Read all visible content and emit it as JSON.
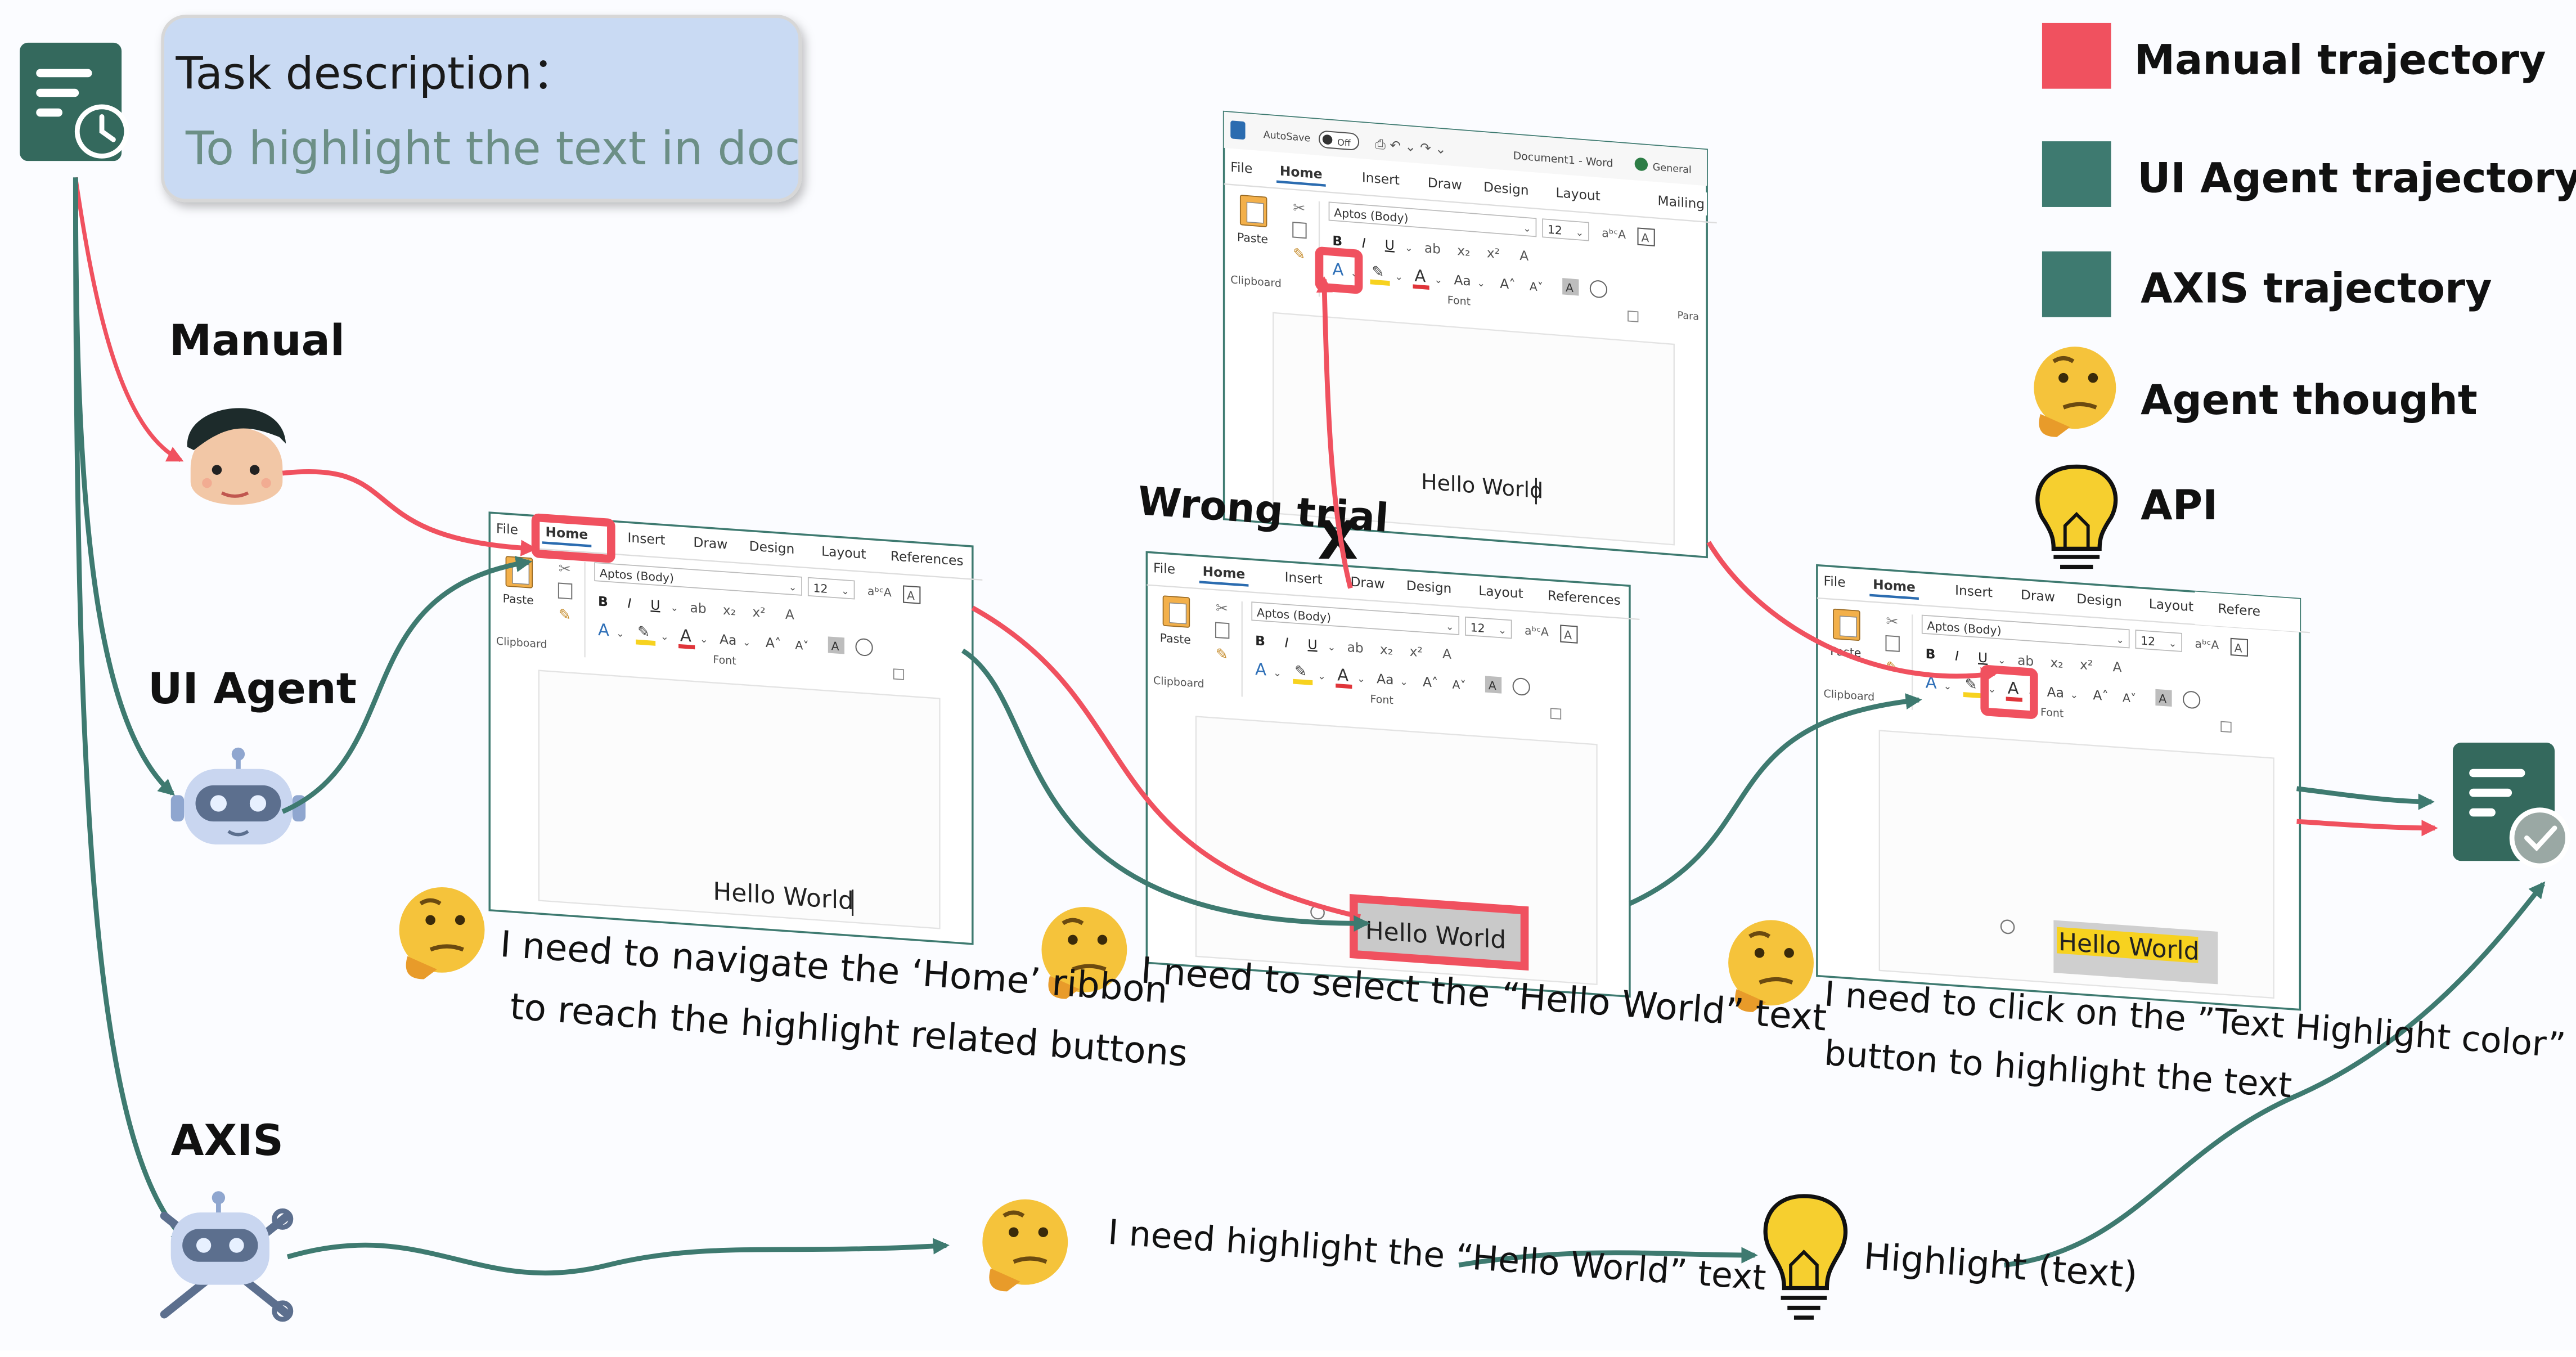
{
  "task": {
    "title": "Task description：",
    "text": "To highlight the text in doc"
  },
  "actors": {
    "manual": "Manual",
    "ui_agent": "UI Agent",
    "axis": "AXIS"
  },
  "legend": {
    "manual": "Manual trajectory",
    "ui_agent": "UI Agent trajectory",
    "axis": "AXIS trajectory",
    "thought": "Agent thought",
    "api": "API"
  },
  "colors": {
    "manual": "#f0515f",
    "agent": "#3e7a70",
    "task_box": "#c9daf3",
    "task_text": "#6c8f86",
    "emoji": "#f5c33b",
    "bulb": "#f6cf2f",
    "doc_icon": "#34695d"
  },
  "ribbon": {
    "file": "File",
    "tabs": [
      "Home",
      "Insert",
      "Draw",
      "Design",
      "Layout",
      "References"
    ],
    "tab_refe": "Refere",
    "tab_mailing": "Mailing",
    "paste": "Paste",
    "clipboard": "Clipboard",
    "font_name": "Aptos (Body)",
    "font_size": "12",
    "font_group": "Font",
    "para_group": "Para",
    "autosave": "AutoSave",
    "off": "Off",
    "doc_title": "Document1 - Word",
    "general": "General",
    "doc_text": "Hello World"
  },
  "steps": {
    "wrong_trial": "Wrong trial",
    "wrong_mark": "X",
    "thought1_l1": "I need to navigate the ‘Home’ ribbon",
    "thought1_l2": "to reach the highlight related buttons",
    "thought2": "I need to select the “Hello World” text",
    "thought3_l1": "I need to click on the ”Text Highlight color”",
    "thought3_l2": "button to highlight the text",
    "axis_thought": "I need highlight the “Hello World” text",
    "api_call": "Highlight (text)"
  }
}
